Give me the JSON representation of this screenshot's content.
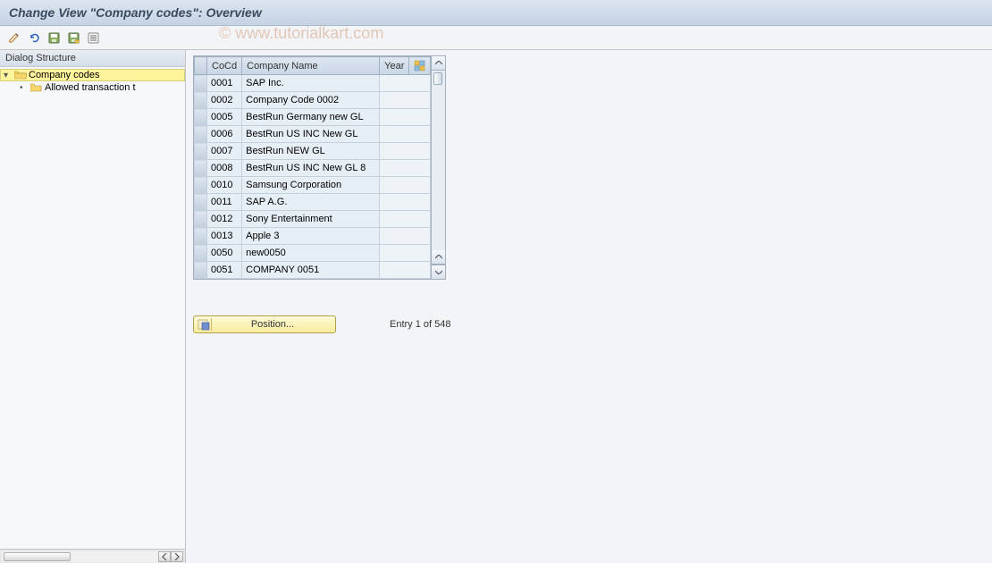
{
  "title": "Change View \"Company codes\": Overview",
  "watermark": "© www.tutorialkart.com",
  "toolbar": {
    "icons": [
      "pencil-icon",
      "undo-icon",
      "save-icon",
      "save-all-icon",
      "list-icon"
    ]
  },
  "sidebar": {
    "header": "Dialog Structure",
    "items": [
      {
        "label": "Company codes",
        "selected": true,
        "open": true
      },
      {
        "label": "Allowed transaction t",
        "selected": false,
        "open": false
      }
    ]
  },
  "table": {
    "columns": {
      "cocd": "CoCd",
      "name": "Company Name",
      "year": "Year"
    },
    "rows": [
      {
        "cocd": "0001",
        "name": "SAP Inc.",
        "year": ""
      },
      {
        "cocd": "0002",
        "name": "Company Code 0002",
        "year": ""
      },
      {
        "cocd": "0005",
        "name": "BestRun Germany new GL",
        "year": ""
      },
      {
        "cocd": "0006",
        "name": "BestRun US INC New GL",
        "year": ""
      },
      {
        "cocd": "0007",
        "name": "BestRun NEW GL",
        "year": ""
      },
      {
        "cocd": "0008",
        "name": "BestRun US INC New GL 8",
        "year": ""
      },
      {
        "cocd": "0010",
        "name": "Samsung Corporation",
        "year": ""
      },
      {
        "cocd": "0011",
        "name": "SAP A.G.",
        "year": ""
      },
      {
        "cocd": "0012",
        "name": "Sony Entertainment",
        "year": ""
      },
      {
        "cocd": "0013",
        "name": "Apple 3",
        "year": ""
      },
      {
        "cocd": "0050",
        "name": "new0050",
        "year": ""
      },
      {
        "cocd": "0051",
        "name": "COMPANY 0051",
        "year": ""
      }
    ]
  },
  "footer": {
    "position_label": "Position...",
    "entry_text": "Entry 1 of 548"
  }
}
